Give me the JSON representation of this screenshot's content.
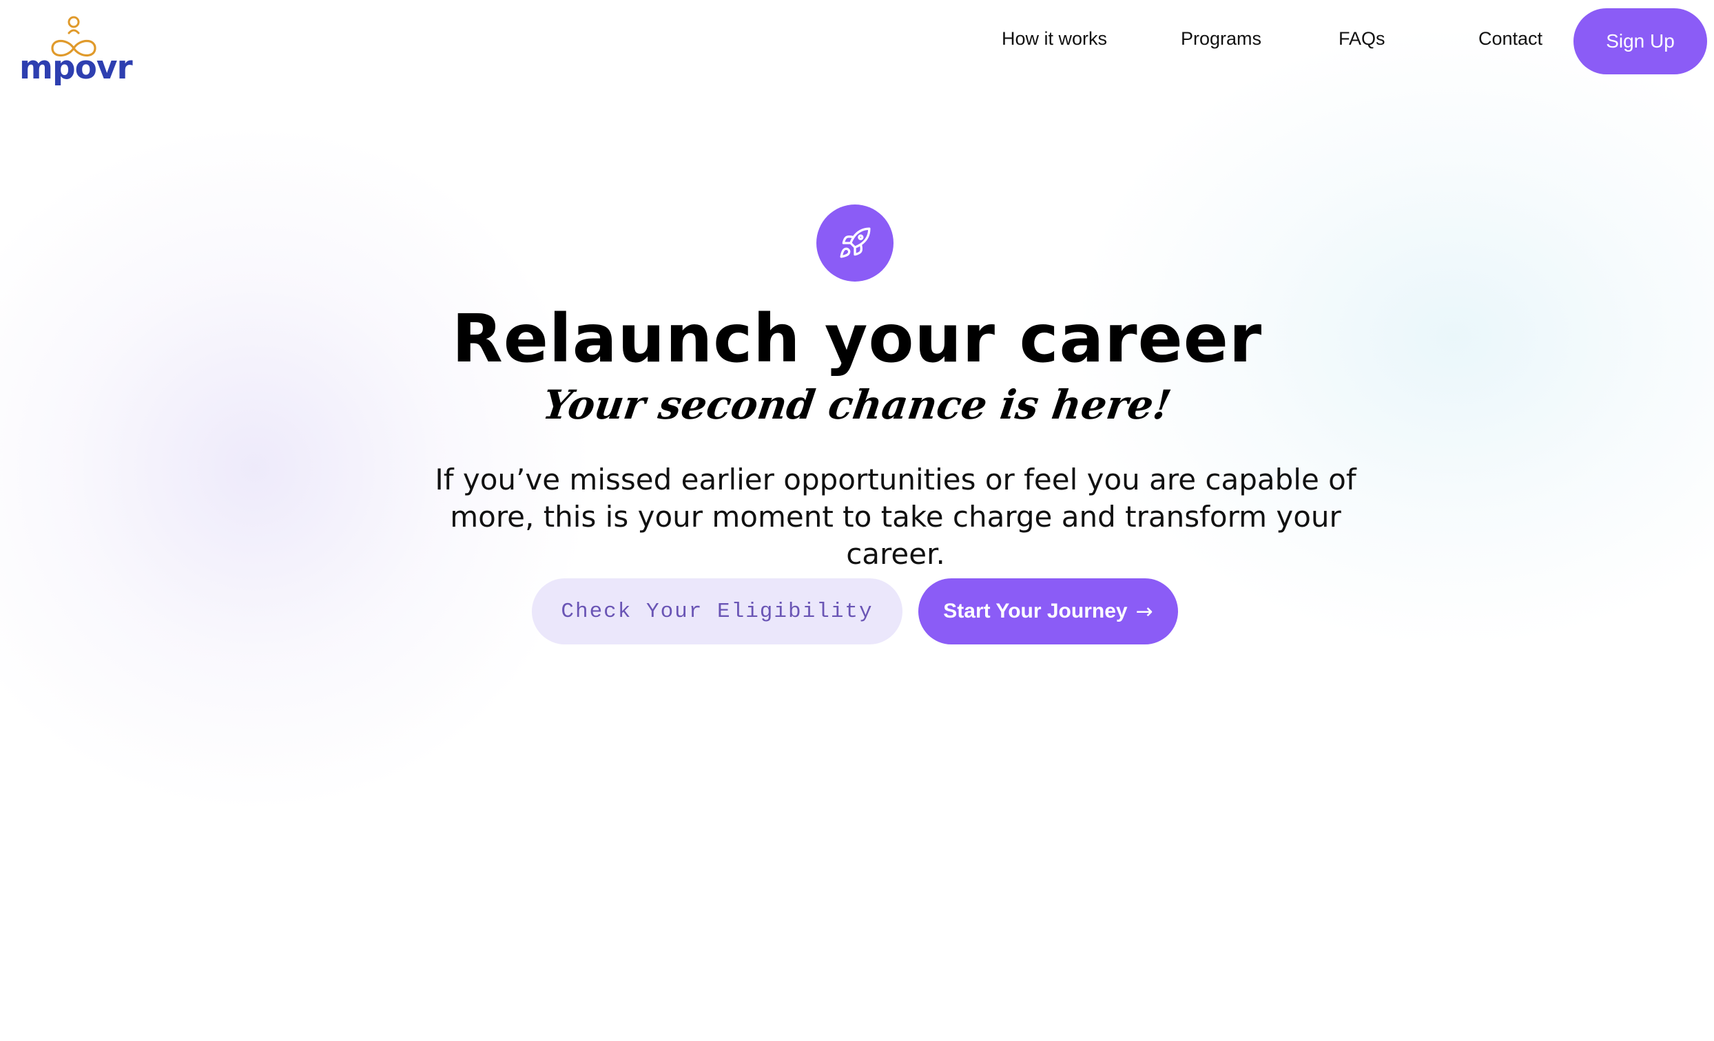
{
  "brand": {
    "logo_text": "mpovr",
    "logo_icon": "person-infinity-logo-icon",
    "logo_text_color": "#2e3fb0",
    "logo_icon_color": "#e09a2b"
  },
  "nav": {
    "items": [
      {
        "label": "How it works"
      },
      {
        "label": "Programs"
      },
      {
        "label": "FAQs"
      },
      {
        "label": "Contact"
      }
    ],
    "signup_label": "Sign Up"
  },
  "hero": {
    "icon": "rocket-icon",
    "title": "Relaunch your career",
    "subtitle": "Your second chance is here!",
    "description": "If you’ve missed earlier opportunities or feel you are capable of more, this is your moment to take charge and transform your career.",
    "secondary_cta": "Check Your Eligibility",
    "primary_cta": "Start Your Journey",
    "primary_cta_icon": "arrow-right-icon"
  },
  "colors": {
    "accent": "#8b5cf6",
    "secondary_button_bg": "#ebe7fb",
    "secondary_button_text": "#6a55b5"
  }
}
